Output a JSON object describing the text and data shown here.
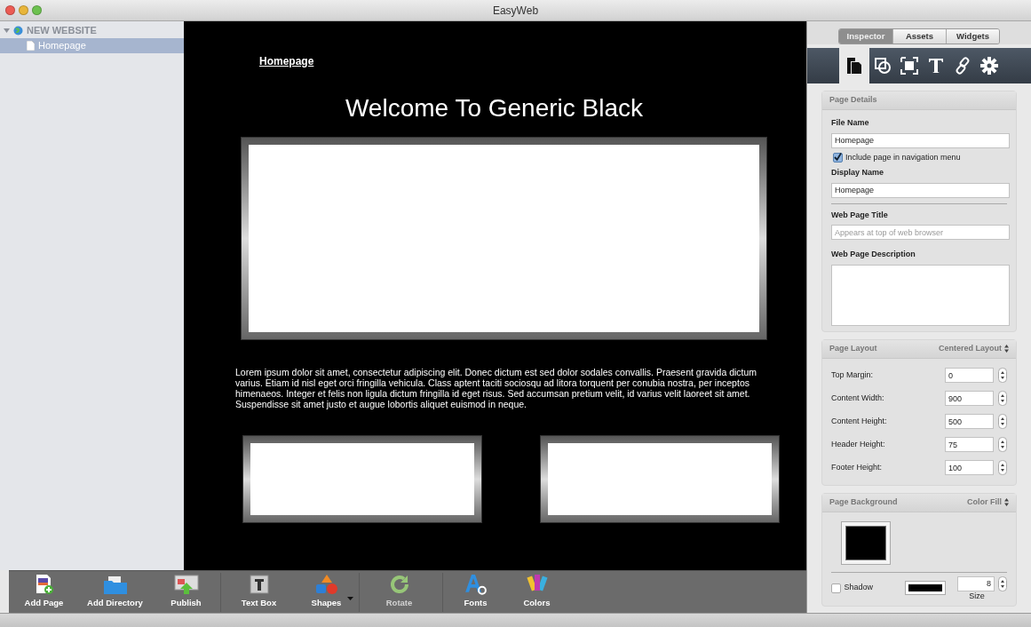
{
  "window": {
    "title": "EasyWeb"
  },
  "sidebar": {
    "items": [
      {
        "label": "NEW WEBSITE",
        "expanded": true,
        "selected": false,
        "children": [
          {
            "label": "Homepage",
            "selected": true
          }
        ]
      }
    ]
  },
  "canvas": {
    "nav_link": "Homepage",
    "heading": "Welcome To Generic Black",
    "paragraph": "Lorem ipsum dolor sit amet, consectetur adipiscing elit. Donec dictum est sed dolor sodales convallis. Praesent gravida dictum varius. Etiam id nisl eget orci fringilla vehicula. Class aptent taciti sociosqu ad litora torquent per conubia nostra, per inceptos himenaeos. Integer et felis non ligula dictum fringilla id eget risus. Sed accumsan pretium velit, id varius velit laoreet sit amet. Suspendisse sit amet justo et augue lobortis aliquet euismod in neque."
  },
  "toolbar": [
    {
      "label": "Add Page",
      "kind": "add-page",
      "disabled": false,
      "menu": false,
      "group_start": false
    },
    {
      "label": "Add Directory",
      "kind": "folder",
      "disabled": false,
      "menu": false,
      "group_start": false
    },
    {
      "label": "Publish",
      "kind": "publish",
      "disabled": false,
      "menu": false,
      "group_start": false
    },
    {
      "label": "Text Box",
      "kind": "text-box",
      "disabled": false,
      "menu": false,
      "group_start": true
    },
    {
      "label": "Shapes",
      "kind": "shapes",
      "disabled": false,
      "menu": true,
      "group_start": false
    },
    {
      "label": "Rotate",
      "kind": "rotate",
      "disabled": true,
      "menu": false,
      "group_start": true
    },
    {
      "label": "Fonts",
      "kind": "fonts",
      "disabled": false,
      "menu": false,
      "group_start": true
    },
    {
      "label": "Colors",
      "kind": "colors",
      "disabled": false,
      "menu": false,
      "group_start": false
    }
  ],
  "inspector": {
    "tabs": [
      {
        "label": "Inspector",
        "selected": true
      },
      {
        "label": "Assets",
        "selected": false
      },
      {
        "label": "Widgets",
        "selected": false
      }
    ],
    "tool_tabs": [
      {
        "kind": "page",
        "selected": true
      },
      {
        "kind": "shape",
        "selected": false
      },
      {
        "kind": "frame",
        "selected": false
      },
      {
        "kind": "text",
        "selected": false
      },
      {
        "kind": "link",
        "selected": false
      },
      {
        "kind": "gear",
        "selected": false
      }
    ],
    "page_details": {
      "title": "Page Details",
      "file_name_label": "File Name",
      "file_name": "Homepage",
      "include_nav": {
        "label": "Include page in navigation menu",
        "checked": true
      },
      "display_name_label": "Display Name",
      "display_name": "Homepage",
      "web_title_label": "Web Page Title",
      "web_title_placeholder": "Appears at top of web browser",
      "description_label": "Web Page Description"
    },
    "page_layout": {
      "title": "Page Layout",
      "mode": "Centered Layout",
      "fields": [
        {
          "label": "Top Margin:",
          "value": "0"
        },
        {
          "label": "Content Width:",
          "value": "900"
        },
        {
          "label": "Content Height:",
          "value": "500"
        },
        {
          "label": "Header Height:",
          "value": "75"
        },
        {
          "label": "Footer Height:",
          "value": "100"
        }
      ]
    },
    "page_background": {
      "title": "Page Background",
      "mode": "Color Fill",
      "color": "#000000",
      "shadow": {
        "label": "Shadow",
        "checked": false,
        "color": "#000000",
        "size": "8",
        "size_label": "Size"
      }
    }
  }
}
